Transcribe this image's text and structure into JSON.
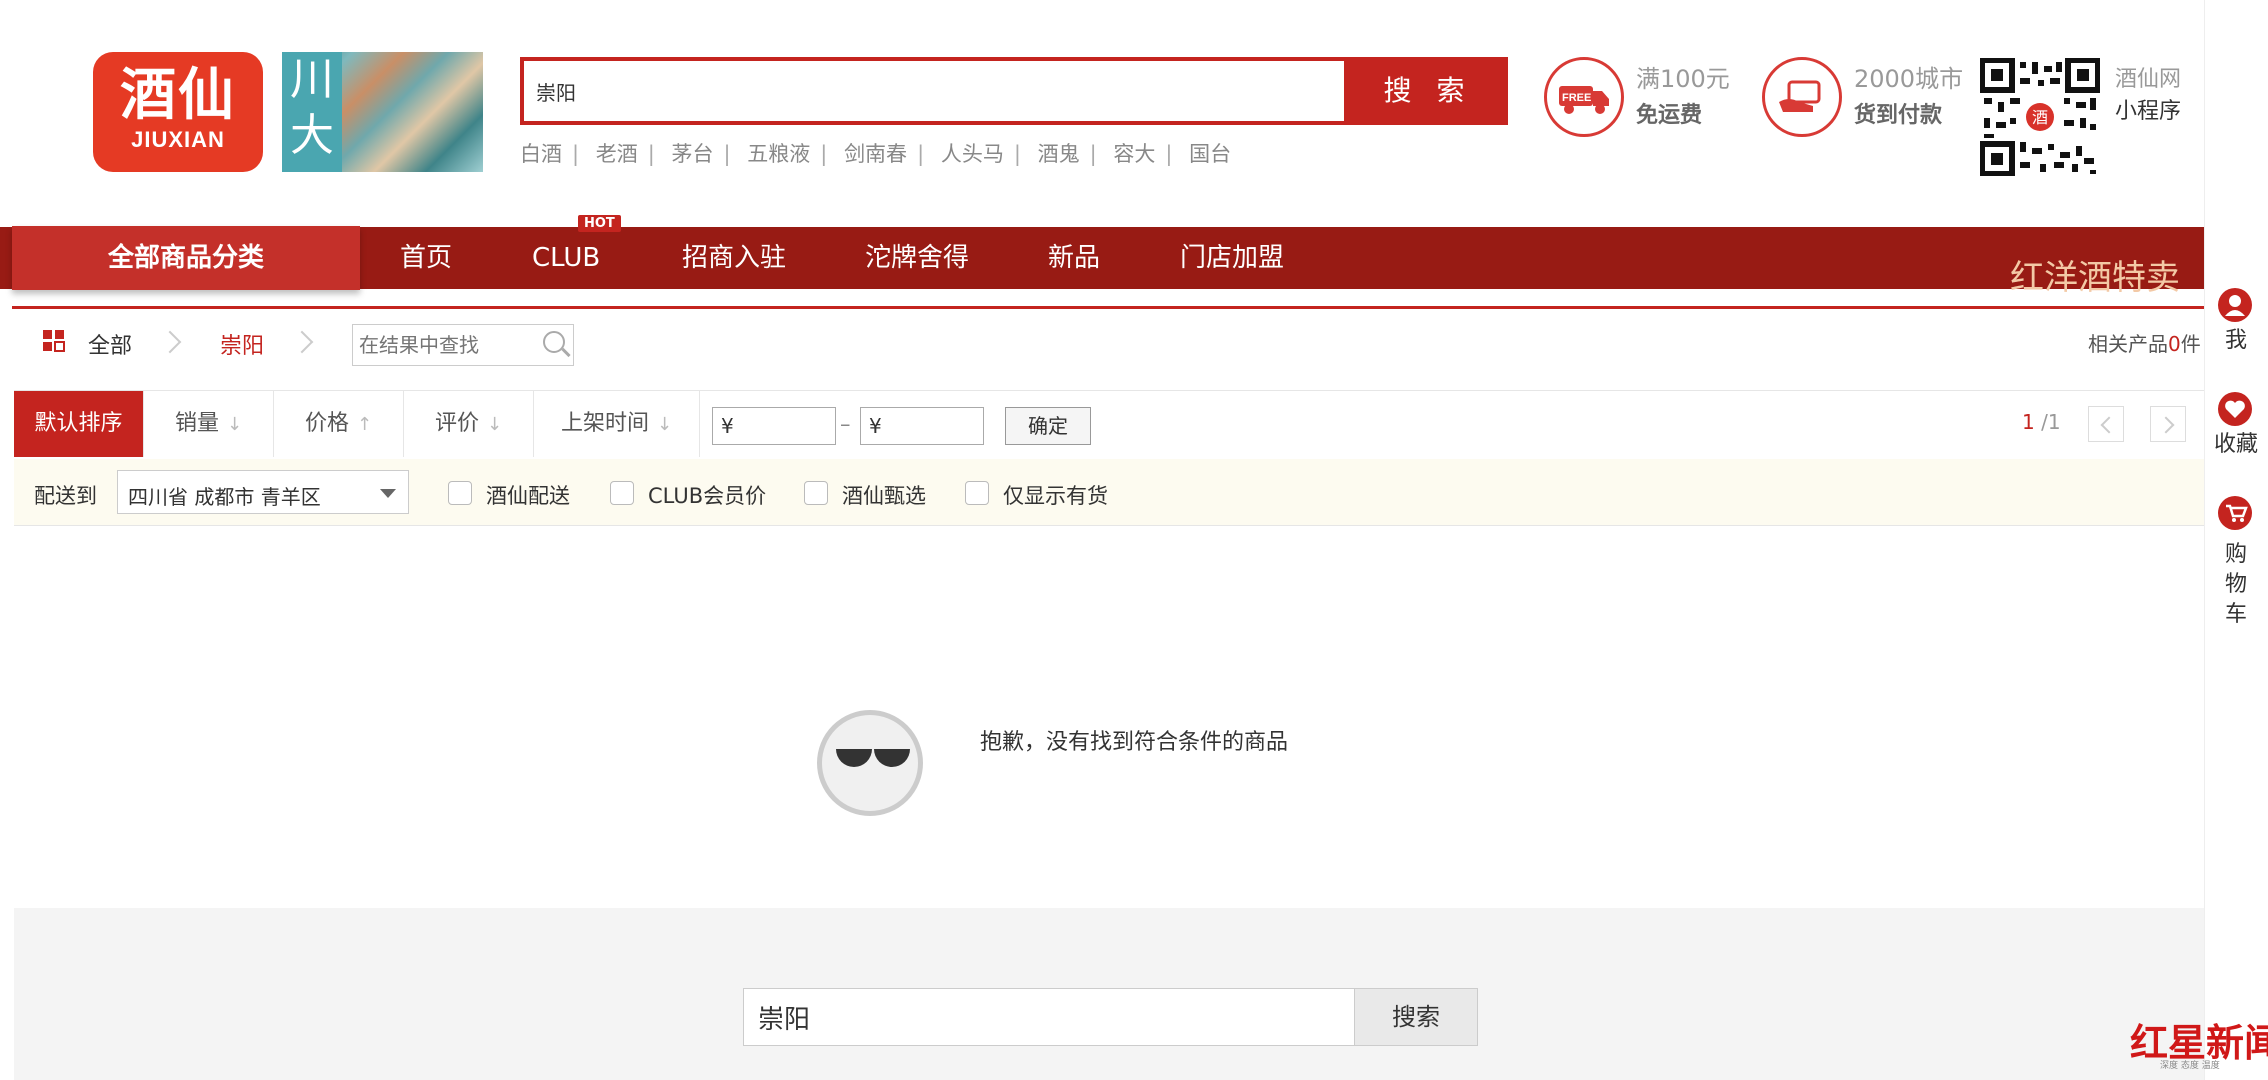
{
  "header": {
    "logo_cn": "酒仙",
    "logo_en": "JIUXIAN",
    "banner_text": "川大",
    "search_value": "崇阳",
    "search_button": "搜 索",
    "hot_words": [
      "白酒",
      "老酒",
      "茅台",
      "五粮液",
      "剑南春",
      "人头马",
      "酒鬼",
      "容大",
      "国台"
    ],
    "promo1": {
      "badge": "FREE",
      "line1": "满100元",
      "line2": "免运费"
    },
    "promo2": {
      "line1": "2000城市",
      "line2": "货到付款"
    },
    "qr_badge": "酒",
    "qr_label1": "酒仙网",
    "qr_label2": "小程序"
  },
  "nav": {
    "all_categories": "全部商品分类",
    "items": [
      "首页",
      "CLUB",
      "招商入驻",
      "沱牌舍得",
      "新品",
      "门店加盟"
    ],
    "hot_badge": "HOT",
    "right_promo": "红洋酒特卖"
  },
  "breadcrumb": {
    "all": "全部",
    "current": "崇阳",
    "filter_placeholder": "在结果中查找",
    "related_prefix": "相关产品",
    "related_count": "0",
    "related_suffix": "件"
  },
  "sort": {
    "options": [
      "默认排序",
      "销量",
      "价格",
      "评价",
      "上架时间"
    ],
    "arrows": [
      "↓",
      "↑",
      "↓",
      "↓"
    ],
    "price_symbol": "¥",
    "price_dash": "–",
    "confirm": "确定",
    "page_current": "1",
    "page_total": "/1"
  },
  "delivery": {
    "label": "配送到",
    "region": "四川省  成都市  青羊区",
    "checkboxes": [
      "酒仙配送",
      "CLUB会员价",
      "酒仙甄选",
      "仅显示有货"
    ]
  },
  "empty_message": "抱歉，没有找到符合条件的商品",
  "bottom_search": {
    "value": "崇阳",
    "button": "搜索"
  },
  "sidebar": {
    "items": [
      {
        "label": "我",
        "icon": "user-icon"
      },
      {
        "label": "收藏",
        "icon": "heart-icon"
      },
      {
        "label": "购物车",
        "icon": "cart-icon"
      }
    ]
  },
  "watermark": {
    "text": "红星新闻",
    "sub": "深度 态度 温度"
  },
  "colors": {
    "brand_red": "#c4241f",
    "nav_dark_red": "#981b14"
  }
}
